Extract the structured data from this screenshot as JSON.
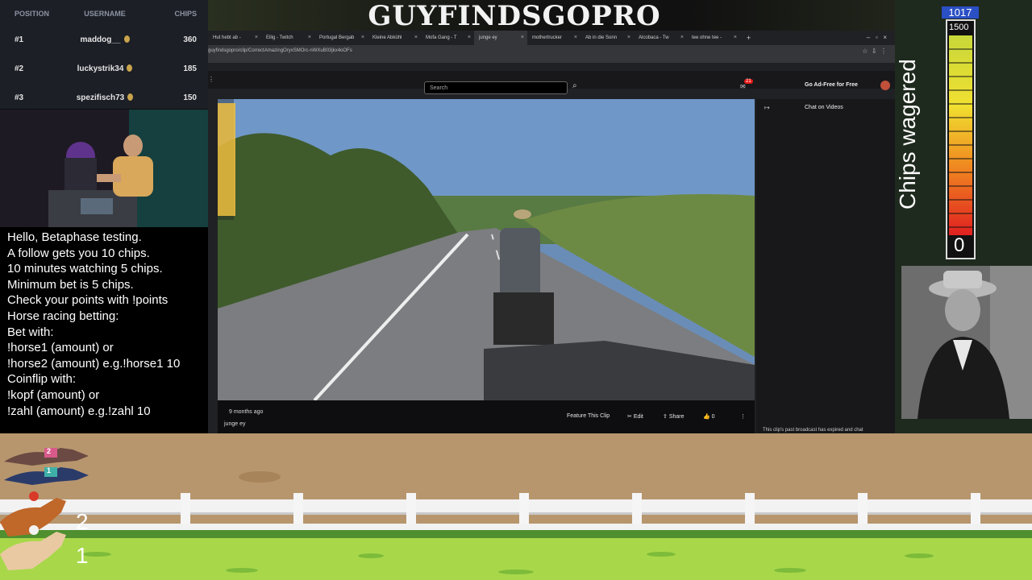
{
  "stream_title": "GUYFINDSGOPRO",
  "leaderboard": {
    "headers": {
      "position": "POSITION",
      "username": "USERNAME",
      "chips": "CHIPS"
    },
    "rows": [
      {
        "pos": "#1",
        "user": "maddog__",
        "chips": "360"
      },
      {
        "pos": "#2",
        "user": "luckystrik34",
        "chips": "185"
      },
      {
        "pos": "#3",
        "user": "spezifisch73",
        "chips": "150"
      }
    ]
  },
  "instructions": [
    "Hello, Betaphase testing.",
    "A follow gets you 10 chips.",
    "10 minutes watching 5 chips.",
    "Minimum bet is 5 chips.",
    "Check your points with !points",
    "Horse racing betting:",
    "Bet with:",
    "!horse1 (amount) or",
    "!horse2 (amount) e.g.!horse1 10",
    "Coinflip with:",
    "!kopf (amount) or",
    "!zahl (amount) e.g.!zahl 10"
  ],
  "browser": {
    "tabs": [
      "Hut hebt ab -",
      "Eilig - Twitch",
      "Portugal Bergab",
      "Kleine Abkühl",
      "Mofa Gang - T",
      "junge ey",
      "mothertrucker",
      "Ab in die Sonn",
      "Alcobaca - Tw",
      "tee ohne tee -"
    ],
    "active_tab": 5,
    "url": "guyfindsgopro/clip/CorrectAmazingOryxSMOrc-nWXuB03jkx4oOFs",
    "search_placeholder": "Search",
    "notification_count": "21",
    "ad_free_label": "Go Ad-Free for Free",
    "chat_header": "Chat on Videos",
    "chat_footer": "This clip's past broadcast has expired and chat",
    "clip_age": "9 months ago",
    "clip_title": "junge ey",
    "feature_clip": "Feature This Clip",
    "edit": "Edit",
    "share": "Share",
    "likes": "0"
  },
  "meter": {
    "label": "Chips wagered",
    "top_value": "1017",
    "max": "1500",
    "current": "0",
    "level": 0
  },
  "race": {
    "dog_numbers": [
      "2",
      "1"
    ],
    "horse_numbers": [
      "2",
      "1"
    ]
  }
}
